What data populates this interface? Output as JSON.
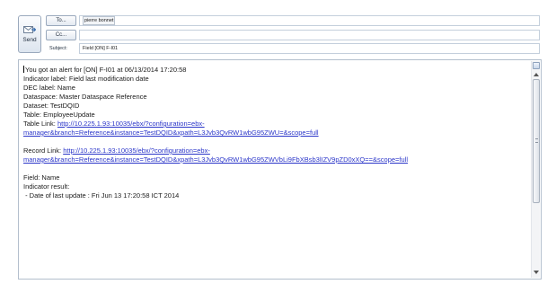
{
  "header": {
    "send_label": "Send",
    "to_button": "To...",
    "cc_button": "Cc...",
    "subject_label": "Subject:",
    "to_value": "pierre bonnet",
    "cc_value": "",
    "subject_value": "Field [ON] F-I01"
  },
  "body": {
    "line1": "You got an alert for [ON] F-I01 at 06/13/2014 17:20:58",
    "line2": "Indicator label: Field last modification date",
    "line3": "DEC label: Name",
    "line4": "Dataspace: Master Dataspace Reference",
    "line5": "Dataset: TestDQID",
    "line6": "Table: EmployeeUpdate",
    "table_link_label": "Table Link: ",
    "table_link_part1": "http://10.225.1.93:10035/ebx/?configuration=ebx-",
    "table_link_part2": "manager&branch=Reference&instance=TestDQID&xpath=L3Jvb3QvRW1wbG95ZWU=&scope=full",
    "record_link_label": "Record Link: ",
    "record_link_part1": "http://10.225.1.93:10035/ebx/?configuration=ebx-",
    "record_link_part2": "manager&branch=Reference&instance=TestDQID&xpath=L3Jvb3QvRW1wbG95ZWVbLi9FbXBsb3lIZV9pZD0xXQ==&scope=full",
    "field_line": "Field: Name",
    "indicator_result": "Indicator result:",
    "date_line": " - Date of last update : Fri Jun 13 17:20:58 ICT 2014"
  }
}
